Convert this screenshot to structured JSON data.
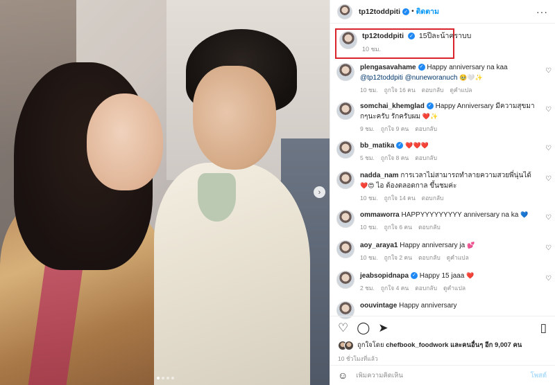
{
  "header": {
    "username": "tp12toddpiti",
    "separator": "•",
    "follow_label": "ติดตาม",
    "more": "···"
  },
  "caption": {
    "username": "tp12toddpiti",
    "text": "15ปีละน้าคราบบ",
    "time": "10 ชม."
  },
  "comments": [
    {
      "username": "plengasavahame",
      "verified": true,
      "text": "Happy anniversary na kaa",
      "mention1": "@tp12toddpiti",
      "mention2": "@nuneworanuch",
      "emoji": "🥹🤍✨",
      "time": "10 ชม.",
      "likes": "ถูกใจ 16 คน",
      "reply": "ตอบกลับ",
      "translate": "ดูคำแปล"
    },
    {
      "username": "somchai_khemglad",
      "verified": true,
      "text": "Happy Anniversary มีความสุขมากๆนะครับ รักครับผม",
      "emoji": "❤️✨",
      "time": "9 ชม.",
      "likes": "ถูกใจ 9 คน",
      "reply": "ตอบกลับ"
    },
    {
      "username": "bb_matika",
      "verified": true,
      "text": "",
      "emoji": "❤️❤️❤️",
      "time": "5 ชม.",
      "likes": "ถูกใจ 8 คน",
      "reply": "ตอบกลับ"
    },
    {
      "username": "nadda_nam",
      "verified": false,
      "text": "การเวลาไม่สามารถทำลายความสวยพี่นุ่นได้",
      "emoji": "❤️😍",
      "text2": "ไอ ต้องตลอดกาล ขึ้นชมค่ะ",
      "time": "10 ชม.",
      "likes": "ถูกใจ 14 คน",
      "reply": "ตอบกลับ"
    },
    {
      "username": "ommaworra",
      "verified": false,
      "text": "HAPPYYYYYYYYY anniversary na ka",
      "emoji": "💙",
      "time": "10 ชม.",
      "likes": "ถูกใจ 6 คน",
      "reply": "ตอบกลับ"
    },
    {
      "username": "aoy_araya1",
      "verified": false,
      "text": "Happy anniversary ja",
      "emoji": "💕",
      "time": "10 ชม.",
      "likes": "ถูกใจ 2 คน",
      "reply": "ตอบกลับ",
      "translate": "ดูคำแปล"
    },
    {
      "username": "jeabsopidnapa",
      "verified": true,
      "text": "Happy 15 jaaa",
      "emoji": "❤️",
      "time": "2 ชม.",
      "likes": "ถูกใจ 4 คน",
      "reply": "ตอบกลับ",
      "translate": "ดูคำแปล"
    },
    {
      "username": "oouvintage",
      "verified": false,
      "text": "Happy anniversary",
      "emoji": ""
    }
  ],
  "actions": {
    "like_icon": "heart-icon",
    "comment_icon": "comment-icon",
    "share_icon": "share-icon",
    "bookmark_icon": "bookmark-icon",
    "liked_prefix": "ถูกใจโดย",
    "liked_user": "chefbook_foodwork",
    "liked_suffix": "และคนอื่นๆ อีก 9,007 คน",
    "time_ago": "10 ชั่วโมงที่แล้ว"
  },
  "add_comment": {
    "placeholder": "เพิ่มความคิดเห็น",
    "post_label": "โพสต์"
  },
  "colors": {
    "accent": "#0095f6",
    "highlight_border": "#d8232a",
    "verified": "#1e88f5"
  }
}
